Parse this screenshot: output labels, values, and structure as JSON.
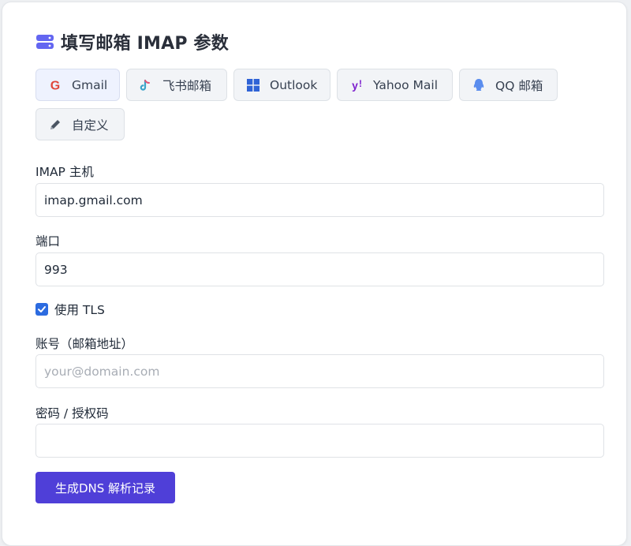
{
  "heading": {
    "title": "填写邮箱 IMAP 参数",
    "icon": "server-icon",
    "icon_color": "#6366f1"
  },
  "providers": [
    {
      "label": "Gmail",
      "icon": "google-icon",
      "active": true
    },
    {
      "label": "飞书邮箱",
      "icon": "lark-icon"
    },
    {
      "label": "Outlook",
      "icon": "windows-icon"
    },
    {
      "label": "Yahoo Mail",
      "icon": "yahoo-icon"
    },
    {
      "label": "QQ 邮箱",
      "icon": "qq-icon"
    },
    {
      "label": "自定义",
      "icon": "pencil-icon"
    }
  ],
  "form": {
    "host_label": "IMAP 主机",
    "host_value": "imap.gmail.com",
    "port_label": "端口",
    "port_value": "993",
    "tls_label": "使用 TLS",
    "tls_checked": true,
    "account_label": "账号（邮箱地址）",
    "account_value": "",
    "account_placeholder": "your@domain.com",
    "password_label": "密码 / 授权码",
    "password_value": ""
  },
  "submit_label": "生成DNS 解析记录",
  "colors": {
    "accent": "#4f3fd8",
    "checkbox": "#2c6be0"
  }
}
